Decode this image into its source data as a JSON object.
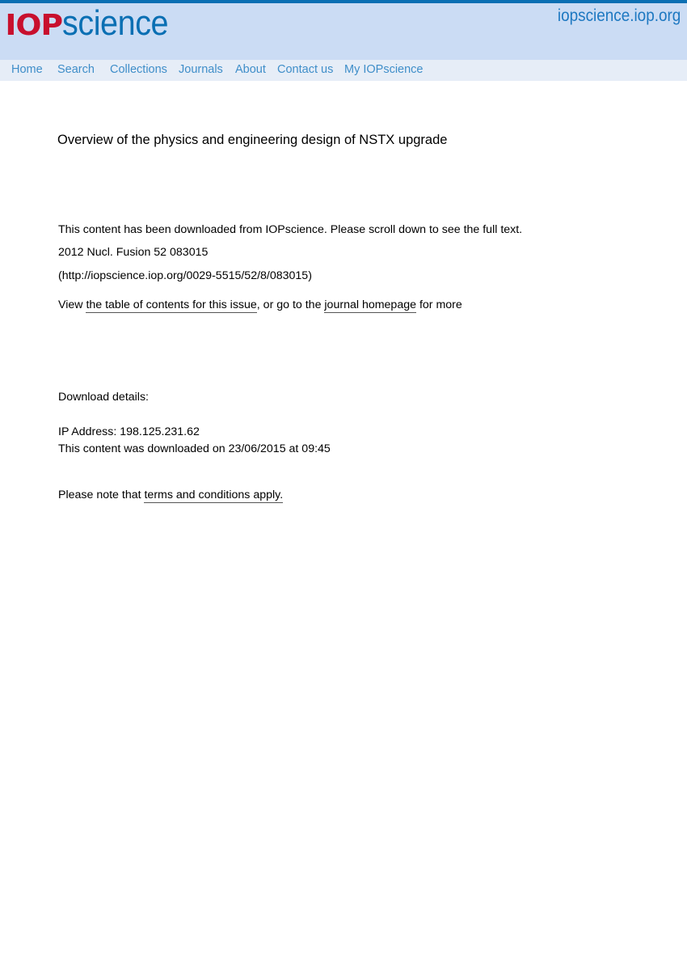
{
  "header": {
    "logo_iop": "IOP",
    "logo_science": "science",
    "site_url": "iopscience.iop.org"
  },
  "nav": {
    "items": [
      {
        "label": "Home"
      },
      {
        "label": "Search"
      },
      {
        "label": "Collections"
      },
      {
        "label": "Journals"
      },
      {
        "label": "About"
      },
      {
        "label": "Contact us"
      },
      {
        "label": "My IOPscience"
      }
    ]
  },
  "article": {
    "title": "Overview of the physics and engineering design of NSTX upgrade",
    "download_notice": "This content has been downloaded from IOPscience. Please scroll down to see the full text.",
    "citation": "2012 Nucl. Fusion 52 083015",
    "url": "(http://iopscience.iop.org/0029-5515/52/8/083015)",
    "view_prefix": "View ",
    "toc_link": "the table of contents for this issue",
    "view_middle": ", or go to the ",
    "journal_link": "journal homepage",
    "view_suffix": " for more"
  },
  "download": {
    "heading": "Download details:",
    "ip_address": "IP Address: 198.125.231.62",
    "downloaded_on": "This content was downloaded on 23/06/2015 at 09:45"
  },
  "terms": {
    "prefix": "Please note that ",
    "link": "terms and conditions apply."
  },
  "colors": {
    "brand_red": "#c8102e",
    "brand_blue": "#0a6fb3",
    "header_bg": "#cbdcf4",
    "nav_bg": "#e6edf7",
    "nav_link": "#3f8ec9"
  }
}
